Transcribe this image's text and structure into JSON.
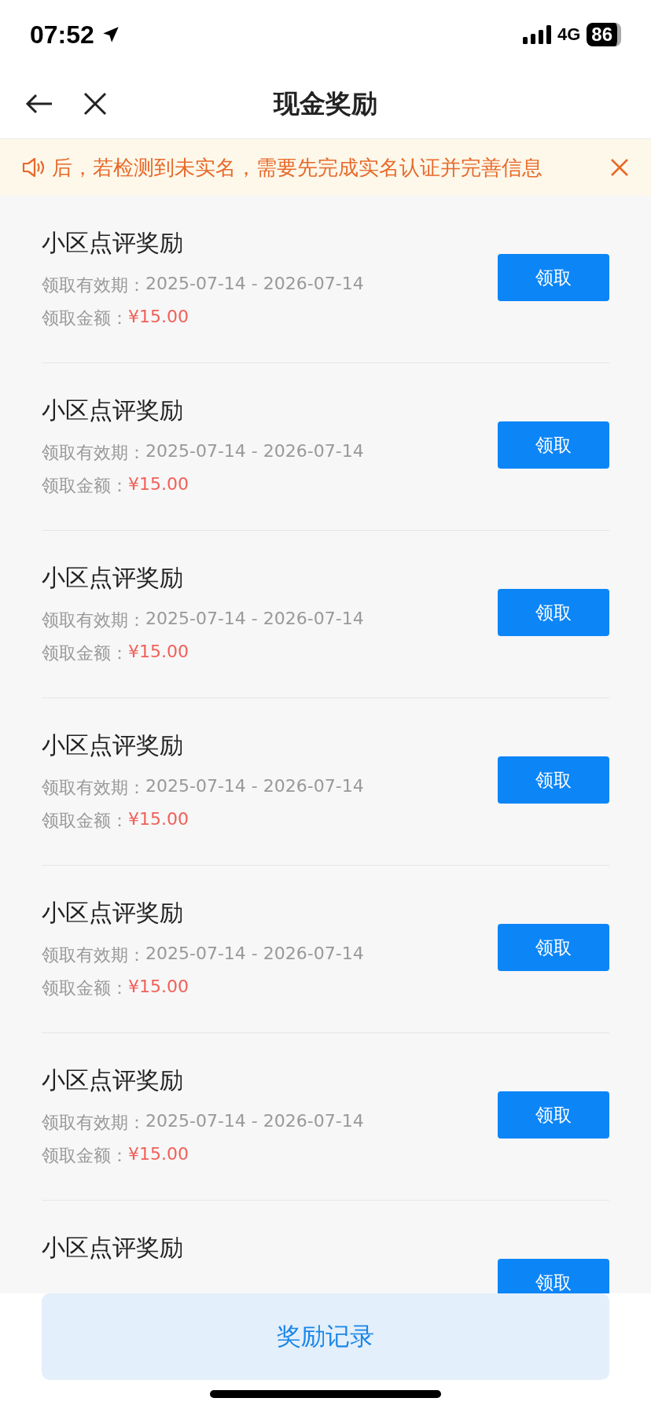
{
  "status_bar": {
    "time": "07:52",
    "network": "4G",
    "battery": "86"
  },
  "nav": {
    "title": "现金奖励"
  },
  "notice": {
    "text": "后，若检测到未实名，需要先完成实名认证并完善信息"
  },
  "rewards": [
    {
      "title": "小区点评奖励",
      "validity_label": "领取有效期：",
      "validity": "2025-07-14 - 2026-07-14",
      "amount_label": "领取金额：",
      "amount": "¥15.00",
      "button": "领取"
    },
    {
      "title": "小区点评奖励",
      "validity_label": "领取有效期：",
      "validity": "2025-07-14 - 2026-07-14",
      "amount_label": "领取金额：",
      "amount": "¥15.00",
      "button": "领取"
    },
    {
      "title": "小区点评奖励",
      "validity_label": "领取有效期：",
      "validity": "2025-07-14 - 2026-07-14",
      "amount_label": "领取金额：",
      "amount": "¥15.00",
      "button": "领取"
    },
    {
      "title": "小区点评奖励",
      "validity_label": "领取有效期：",
      "validity": "2025-07-14 - 2026-07-14",
      "amount_label": "领取金额：",
      "amount": "¥15.00",
      "button": "领取"
    },
    {
      "title": "小区点评奖励",
      "validity_label": "领取有效期：",
      "validity": "2025-07-14 - 2026-07-14",
      "amount_label": "领取金额：",
      "amount": "¥15.00",
      "button": "领取"
    },
    {
      "title": "小区点评奖励",
      "validity_label": "领取有效期：",
      "validity": "2025-07-14 - 2026-07-14",
      "amount_label": "领取金额：",
      "amount": "¥15.00",
      "button": "领取"
    },
    {
      "title": "小区点评奖励",
      "button": "领取"
    }
  ],
  "bottom_button": "奖励记录"
}
